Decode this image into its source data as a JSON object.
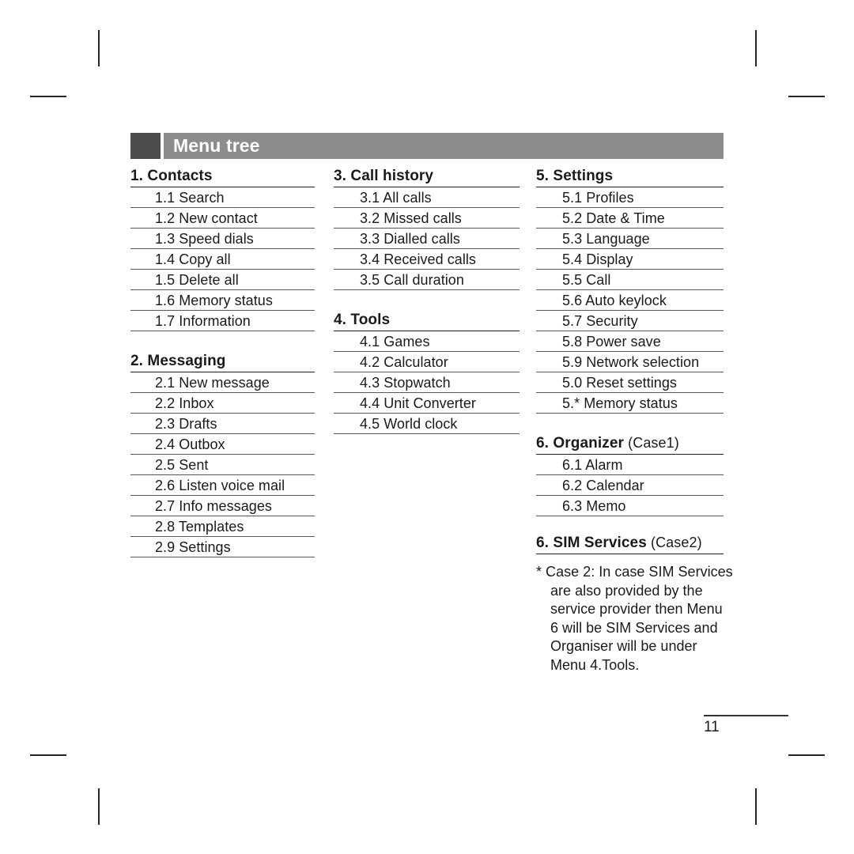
{
  "header": {
    "title": "Menu tree"
  },
  "columns": [
    {
      "id": "column-1",
      "groups": [
        {
          "heading": "1. Contacts",
          "items": [
            "1.1 Search",
            "1.2 New contact",
            "1.3 Speed dials",
            "1.4 Copy all",
            "1.5 Delete all",
            "1.6 Memory status",
            "1.7 Information"
          ]
        },
        {
          "heading": "2. Messaging",
          "items": [
            "2.1 New message",
            "2.2 Inbox",
            "2.3 Drafts",
            "2.4 Outbox",
            "2.5 Sent",
            "2.6 Listen voice mail",
            "2.7 Info messages",
            "2.8 Templates",
            "2.9 Settings"
          ]
        }
      ]
    },
    {
      "id": "column-2",
      "groups": [
        {
          "heading": "3. Call history",
          "items": [
            "3.1 All calls",
            "3.2 Missed calls",
            "3.3 Dialled calls",
            "3.4 Received calls",
            "3.5 Call duration"
          ]
        },
        {
          "heading": "4. Tools",
          "items": [
            "4.1 Games",
            "4.2 Calculator",
            "4.3 Stopwatch",
            "4.4 Unit Converter",
            "4.5 World clock"
          ]
        }
      ]
    },
    {
      "id": "column-3",
      "groups": [
        {
          "heading": "5. Settings",
          "items": [
            "5.1 Profiles",
            "5.2 Date & Time",
            "5.3 Language",
            "5.4 Display",
            "5.5 Call",
            "5.6 Auto keylock",
            "5.7 Security",
            "5.8 Power save",
            "5.9 Network selection",
            "5.0 Reset settings",
            "5.* Memory status"
          ]
        },
        {
          "heading": "6. Organizer",
          "heading_case": " (Case1)",
          "items": [
            "6.1 Alarm",
            "6.2 Calendar",
            "6.3 Memo"
          ]
        },
        {
          "heading": "6. SIM Services",
          "heading_case": " (Case2)",
          "items": []
        }
      ],
      "footnote": "* Case 2: In case SIM Services are also provided by the service provider then Menu 6 will be SIM Services and Organiser will be under Menu 4.Tools."
    }
  ],
  "footer": {
    "page_number": "11"
  }
}
